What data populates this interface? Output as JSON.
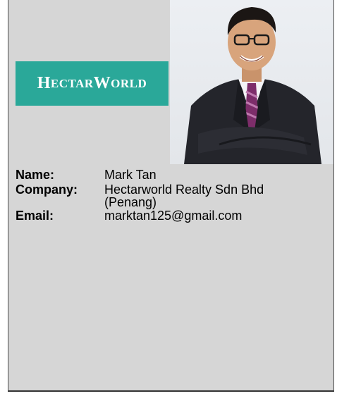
{
  "logo": {
    "text_big_1": "H",
    "text_small_1": "ECTAR",
    "text_big_2": "W",
    "text_small_2": "ORLD",
    "bg_color": "#2aa899"
  },
  "photo": {
    "alt": "agent-photo"
  },
  "details": {
    "name_label": "Name:",
    "name_value": "Mark Tan",
    "company_label": "Company:",
    "company_value_line1": "Hectarworld Realty Sdn Bhd",
    "company_value_line2": "(Penang)",
    "email_label": "Email:",
    "email_value": "marktan125@gmail.com"
  }
}
